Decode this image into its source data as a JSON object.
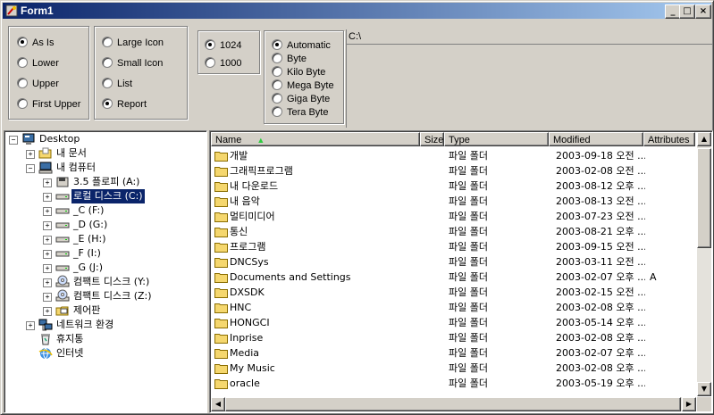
{
  "window": {
    "title": "Form1",
    "min": "_",
    "max": "□",
    "close": "×"
  },
  "case_group": {
    "options": [
      {
        "label": "As Is",
        "selected": true
      },
      {
        "label": "Lower",
        "selected": false
      },
      {
        "label": "Upper",
        "selected": false
      },
      {
        "label": "First Upper",
        "selected": false
      }
    ]
  },
  "view_group": {
    "options": [
      {
        "label": "Large Icon",
        "selected": false
      },
      {
        "label": "Small Icon",
        "selected": false
      },
      {
        "label": "List",
        "selected": false
      },
      {
        "label": "Report",
        "selected": true
      }
    ]
  },
  "unit_group": {
    "options": [
      {
        "label": "1024",
        "selected": true
      },
      {
        "label": "1000",
        "selected": false
      }
    ]
  },
  "size_group": {
    "options": [
      {
        "label": "Automatic",
        "selected": true
      },
      {
        "label": "Byte",
        "selected": false
      },
      {
        "label": "Kilo Byte",
        "selected": false
      },
      {
        "label": "Mega Byte",
        "selected": false
      },
      {
        "label": "Giga Byte",
        "selected": false
      },
      {
        "label": "Tera Byte",
        "selected": false
      }
    ]
  },
  "path": "C:\\",
  "tree": {
    "items": [
      {
        "label": "Desktop",
        "level": 0,
        "expander": "−",
        "icon": "desktop-icon"
      },
      {
        "label": "내 문서",
        "level": 1,
        "expander": "+",
        "icon": "my-documents-icon"
      },
      {
        "label": "내 컴퓨터",
        "level": 1,
        "expander": "−",
        "icon": "my-computer-icon"
      },
      {
        "label": "3.5 플로피 (A:)",
        "level": 2,
        "expander": "+",
        "icon": "floppy-icon"
      },
      {
        "label": "로컬 디스크 (C:)",
        "level": 2,
        "expander": "+",
        "icon": "drive-icon",
        "selected": true
      },
      {
        "label": "_C (F:)",
        "level": 2,
        "expander": "+",
        "icon": "drive-icon"
      },
      {
        "label": "_D (G:)",
        "level": 2,
        "expander": "+",
        "icon": "drive-icon"
      },
      {
        "label": "_E (H:)",
        "level": 2,
        "expander": "+",
        "icon": "drive-icon"
      },
      {
        "label": "_F (I:)",
        "level": 2,
        "expander": "+",
        "icon": "drive-icon"
      },
      {
        "label": "_G (J:)",
        "level": 2,
        "expander": "+",
        "icon": "drive-icon"
      },
      {
        "label": "컴팩트 디스크 (Y:)",
        "level": 2,
        "expander": "+",
        "icon": "cd-drive-icon"
      },
      {
        "label": "컴팩트 디스크 (Z:)",
        "level": 2,
        "expander": "+",
        "icon": "cd-drive-icon"
      },
      {
        "label": "제어판",
        "level": 2,
        "expander": "+",
        "icon": "control-panel-icon"
      },
      {
        "label": "네트워크 환경",
        "level": 1,
        "expander": "+",
        "icon": "network-icon"
      },
      {
        "label": "휴지통",
        "level": 1,
        "expander": "",
        "icon": "recycle-bin-icon"
      },
      {
        "label": "인터넷",
        "level": 1,
        "expander": "",
        "icon": "internet-icon"
      }
    ]
  },
  "list": {
    "headers": {
      "name": "Name",
      "size": "Size",
      "type": "Type",
      "modified": "Modified",
      "attributes": "Attributes"
    },
    "sort_indicator": "▲",
    "rows": [
      {
        "name": "개발",
        "size": "",
        "type": "파일 폴더",
        "modified": "2003-09-18 오전 ...",
        "attributes": ""
      },
      {
        "name": "그래픽프로그램",
        "size": "",
        "type": "파일 폴더",
        "modified": "2003-02-08 오전 ...",
        "attributes": ""
      },
      {
        "name": "내 다운로드",
        "size": "",
        "type": "파일 폴더",
        "modified": "2003-08-12 오후 ...",
        "attributes": ""
      },
      {
        "name": "내 음악",
        "size": "",
        "type": "파일 폴더",
        "modified": "2003-08-13 오전 ...",
        "attributes": ""
      },
      {
        "name": "멀티미디어",
        "size": "",
        "type": "파일 폴더",
        "modified": "2003-07-23 오전 ...",
        "attributes": ""
      },
      {
        "name": "통신",
        "size": "",
        "type": "파일 폴더",
        "modified": "2003-08-21 오후 ...",
        "attributes": ""
      },
      {
        "name": "프로그램",
        "size": "",
        "type": "파일 폴더",
        "modified": "2003-09-15 오전 ...",
        "attributes": ""
      },
      {
        "name": "DNCSys",
        "size": "",
        "type": "파일 폴더",
        "modified": "2003-03-11 오전 ...",
        "attributes": ""
      },
      {
        "name": "Documents and Settings",
        "size": "",
        "type": "파일 폴더",
        "modified": "2003-02-07 오후 ...",
        "attributes": "A"
      },
      {
        "name": "DXSDK",
        "size": "",
        "type": "파일 폴더",
        "modified": "2003-02-15 오전 ...",
        "attributes": ""
      },
      {
        "name": "HNC",
        "size": "",
        "type": "파일 폴더",
        "modified": "2003-02-08 오후 ...",
        "attributes": ""
      },
      {
        "name": "HONGCI",
        "size": "",
        "type": "파일 폴더",
        "modified": "2003-05-14 오후 ...",
        "attributes": ""
      },
      {
        "name": "Inprise",
        "size": "",
        "type": "파일 폴더",
        "modified": "2003-02-08 오후 ...",
        "attributes": ""
      },
      {
        "name": "Media",
        "size": "",
        "type": "파일 폴더",
        "modified": "2003-02-07 오후 ...",
        "attributes": ""
      },
      {
        "name": "My Music",
        "size": "",
        "type": "파일 폴더",
        "modified": "2003-02-08 오후 ...",
        "attributes": ""
      },
      {
        "name": "oracle",
        "size": "",
        "type": "파일 폴더",
        "modified": "2003-05-19 오후 ...",
        "attributes": ""
      }
    ]
  },
  "colors": {
    "titlebar_start": "#0a246a",
    "titlebar_end": "#a6caf0",
    "face": "#d4d0c8",
    "selection": "#0a246a",
    "folder": "#f5d76e",
    "sort_arrow": "#2ecc40"
  }
}
